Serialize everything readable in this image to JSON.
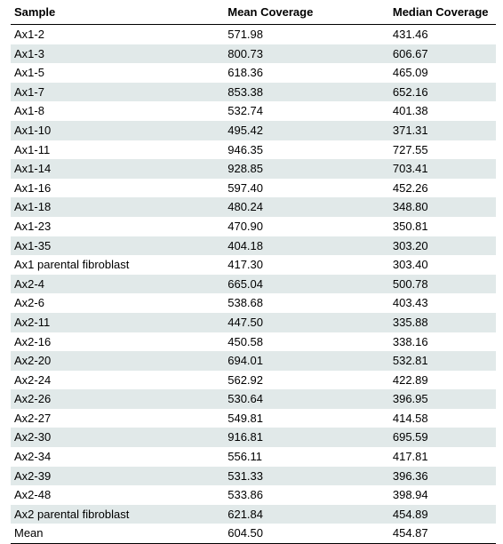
{
  "table": {
    "headers": {
      "sample": "Sample",
      "mean": "Mean Coverage",
      "median": "Median Coverage"
    },
    "rows": [
      {
        "sample": "Ax1-2",
        "mean": "571.98",
        "median": "431.46"
      },
      {
        "sample": "Ax1-3",
        "mean": "800.73",
        "median": "606.67"
      },
      {
        "sample": "Ax1-5",
        "mean": "618.36",
        "median": "465.09"
      },
      {
        "sample": "Ax1-7",
        "mean": "853.38",
        "median": "652.16"
      },
      {
        "sample": "Ax1-8",
        "mean": "532.74",
        "median": "401.38"
      },
      {
        "sample": "Ax1-10",
        "mean": "495.42",
        "median": "371.31"
      },
      {
        "sample": "Ax1-11",
        "mean": "946.35",
        "median": "727.55"
      },
      {
        "sample": "Ax1-14",
        "mean": "928.85",
        "median": "703.41"
      },
      {
        "sample": "Ax1-16",
        "mean": "597.40",
        "median": "452.26"
      },
      {
        "sample": "Ax1-18",
        "mean": "480.24",
        "median": "348.80"
      },
      {
        "sample": "Ax1-23",
        "mean": "470.90",
        "median": "350.81"
      },
      {
        "sample": "Ax1-35",
        "mean": "404.18",
        "median": "303.20"
      },
      {
        "sample": "Ax1 parental fibroblast",
        "mean": "417.30",
        "median": "303.40"
      },
      {
        "sample": "Ax2-4",
        "mean": "665.04",
        "median": "500.78"
      },
      {
        "sample": "Ax2-6",
        "mean": "538.68",
        "median": "403.43"
      },
      {
        "sample": "Ax2-11",
        "mean": "447.50",
        "median": "335.88"
      },
      {
        "sample": "Ax2-16",
        "mean": "450.58",
        "median": "338.16"
      },
      {
        "sample": "Ax2-20",
        "mean": "694.01",
        "median": "532.81"
      },
      {
        "sample": "Ax2-24",
        "mean": "562.92",
        "median": "422.89"
      },
      {
        "sample": "Ax2-26",
        "mean": "530.64",
        "median": "396.95"
      },
      {
        "sample": "Ax2-27",
        "mean": "549.81",
        "median": "414.58"
      },
      {
        "sample": "Ax2-30",
        "mean": "916.81",
        "median": "695.59"
      },
      {
        "sample": "Ax2-34",
        "mean": "556.11",
        "median": "417.81"
      },
      {
        "sample": "Ax2-39",
        "mean": "531.33",
        "median": "396.36"
      },
      {
        "sample": "Ax2-48",
        "mean": "533.86",
        "median": "398.94"
      },
      {
        "sample": "Ax2 parental fibroblast",
        "mean": "621.84",
        "median": "454.89"
      },
      {
        "sample": "Mean",
        "mean": "604.50",
        "median": "454.87"
      }
    ]
  }
}
